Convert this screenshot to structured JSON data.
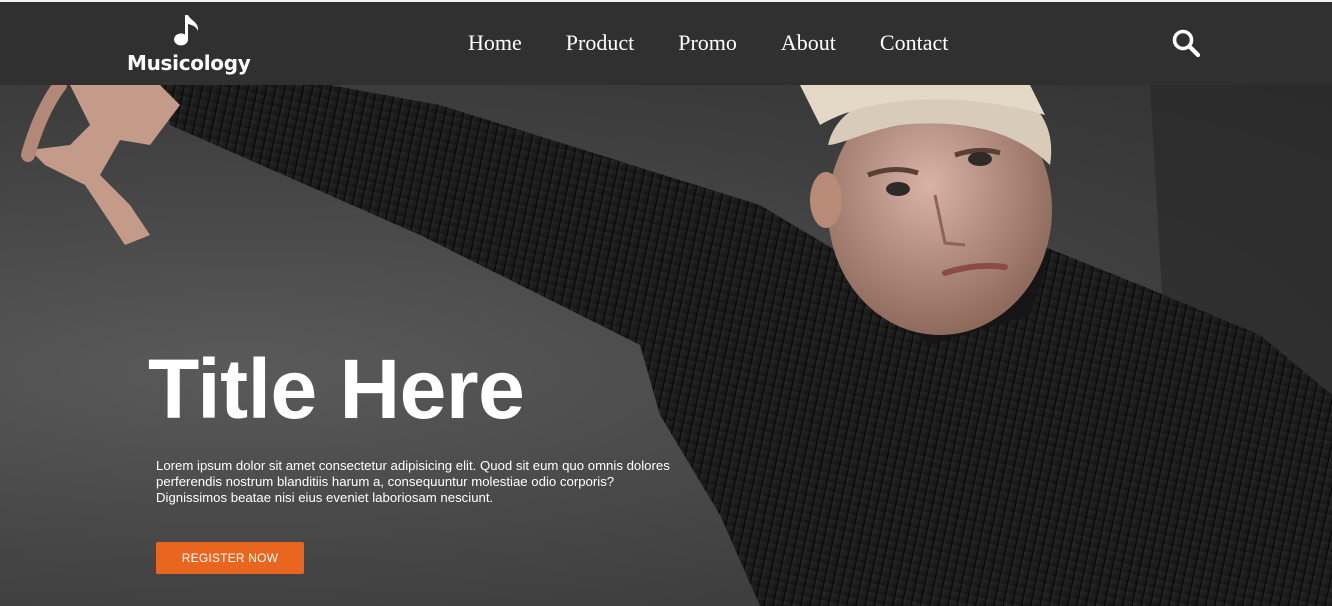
{
  "brand": {
    "name": "Musicology",
    "logo_icon": "music-note-icon"
  },
  "nav": {
    "links": [
      {
        "label": "Home"
      },
      {
        "label": "Product"
      },
      {
        "label": "Promo"
      },
      {
        "label": "About"
      },
      {
        "label": "Contact"
      }
    ],
    "search_icon": "search-icon"
  },
  "hero": {
    "title": "Title Here",
    "text": "Lorem ipsum dolor sit amet consectetur adipisicing elit. Quod sit eum quo omnis dolores perferendis nostrum blanditiis harum a, consequuntur molestiae odio corporis? Dignissimos beatae nisi eius eveniet laboriosam nesciunt.",
    "cta_label": "REGISTER NOW"
  },
  "colors": {
    "navbar": "#303030",
    "accent": "#e8661f",
    "text": "#ffffff"
  }
}
